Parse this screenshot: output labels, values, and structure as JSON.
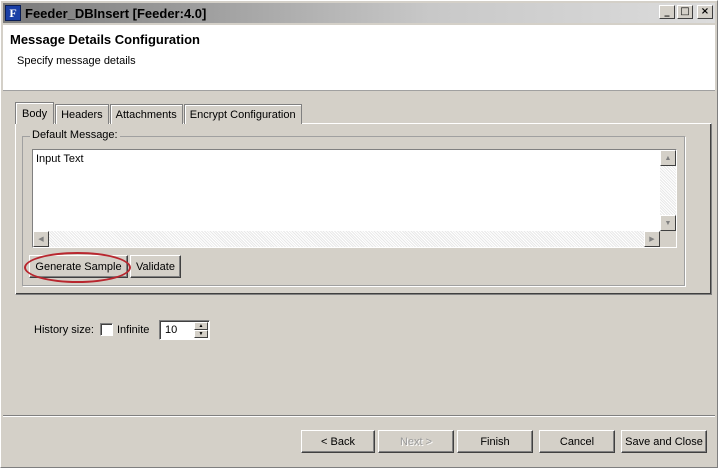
{
  "window": {
    "title": "Feeder_DBInsert [Feeder:4.0]",
    "app_icon_glyph": "F",
    "controls": {
      "minimize": "_",
      "maximize": "□",
      "close": "×"
    }
  },
  "header": {
    "title": "Message Details Configuration",
    "subtitle": "Specify message details"
  },
  "tabs": [
    {
      "label": "Body",
      "active": true
    },
    {
      "label": "Headers",
      "active": false
    },
    {
      "label": "Attachments",
      "active": false
    },
    {
      "label": "Encrypt Configuration",
      "active": false
    }
  ],
  "body_panel": {
    "group_label": "Default Message:",
    "textarea_value": "Input Text",
    "buttons": {
      "generate_sample": "Generate Sample",
      "validate": "Validate"
    }
  },
  "history": {
    "label": "History size:",
    "infinite_label": "Infinite",
    "infinite_checked": false,
    "size_value": "10"
  },
  "footer": {
    "back": "< Back",
    "next": "Next >",
    "finish": "Finish",
    "cancel": "Cancel",
    "save_close": "Save and Close"
  },
  "colors": {
    "dialog_bg": "#d4d0c8",
    "highlight_ring": "#b8262e"
  }
}
